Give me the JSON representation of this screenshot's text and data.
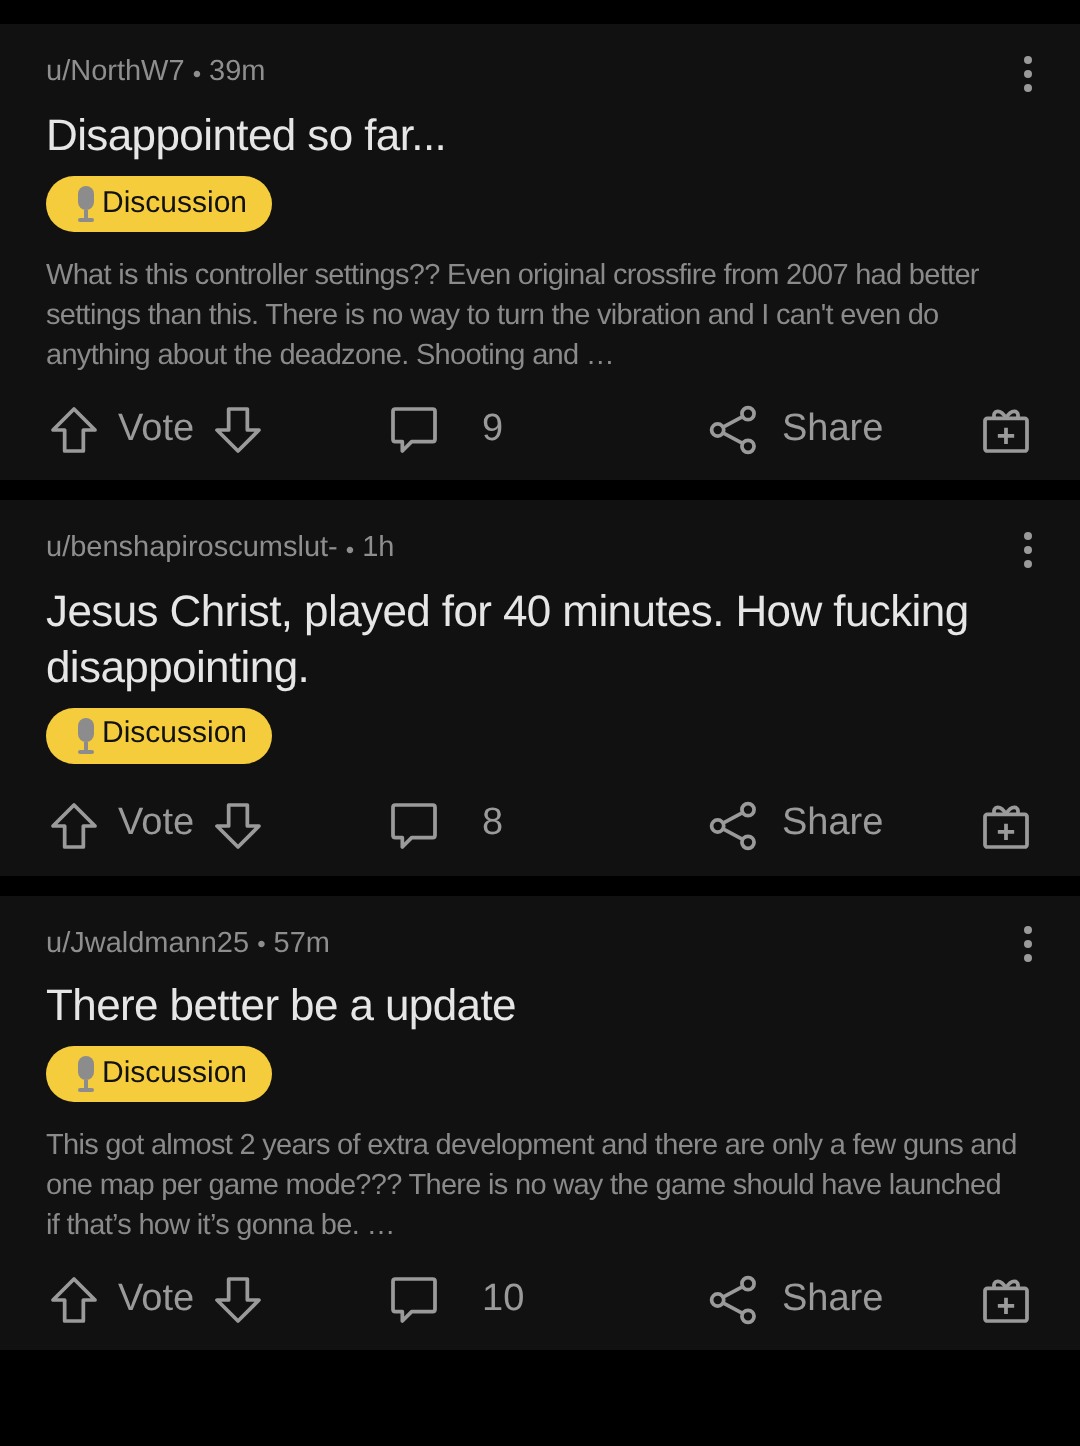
{
  "posts": [
    {
      "author": "u/NorthW7",
      "separator": "•",
      "time": "39m",
      "title": "Disappointed so far...",
      "flair": "Discussion",
      "body": "What is this controller settings?? Even original crossfire from 2007 had better settings than this. There is no way to turn the vibration and I can't even do anything about the deadzone. Shooting and …",
      "vote_label": "Vote",
      "comments": "9",
      "share_label": "Share"
    },
    {
      "author": "u/benshapiroscumslut-",
      "separator": "•",
      "time": "1h",
      "title": "Jesus Christ, played for 40 minutes. How fucking disappointing.",
      "flair": "Discussion",
      "vote_label": "Vote",
      "comments": "8",
      "share_label": "Share"
    },
    {
      "author": "u/Jwaldmann25",
      "separator": "•",
      "time": "57m",
      "title": "There better be a update",
      "flair": "Discussion",
      "body": "This got almost 2 years of extra development and there are only a few guns and one map per game mode???  There is no way the game should have launched if that’s how it’s gonna be. …",
      "vote_label": "Vote",
      "comments": "10",
      "share_label": "Share"
    }
  ]
}
